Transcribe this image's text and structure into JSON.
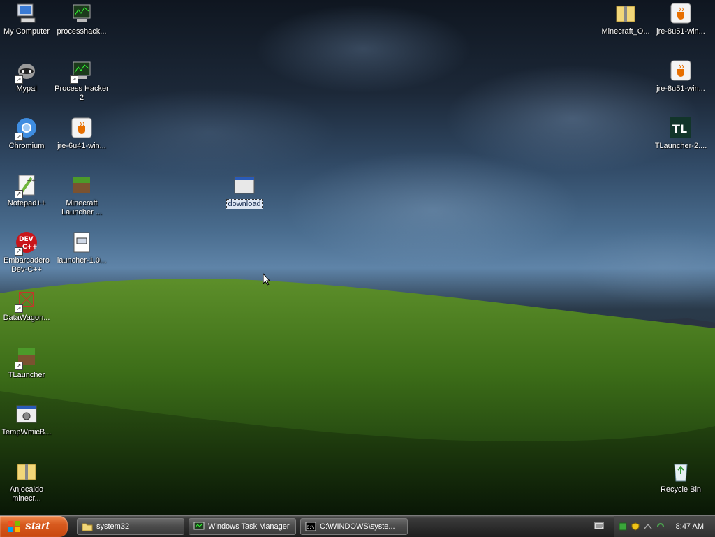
{
  "desktop": {
    "icons_left_col1": [
      {
        "label": "My Computer",
        "icon": "my-computer-icon"
      },
      {
        "label": "Mypal",
        "icon": "mypal-icon"
      },
      {
        "label": "Chromium",
        "icon": "chromium-icon"
      },
      {
        "label": "Notepad++",
        "icon": "notepad-plus-plus-icon"
      },
      {
        "label": "Embarcadero Dev-C++",
        "icon": "devcpp-icon"
      },
      {
        "label": "DataWagon...",
        "icon": "datawagon-icon"
      },
      {
        "label": "TLauncher",
        "icon": "tlauncher-grass-icon"
      },
      {
        "label": "TempWmicB...",
        "icon": "batch-file-icon"
      },
      {
        "label": "Anjocaido minecr...",
        "icon": "zip-folder-icon"
      }
    ],
    "icons_left_col2": [
      {
        "label": "processhack...",
        "icon": "process-hacker-icon"
      },
      {
        "label": "Process Hacker 2",
        "icon": "process-hacker-icon"
      },
      {
        "label": "jre-6u41-win...",
        "icon": "java-installer-icon"
      },
      {
        "label": "Minecraft Launcher ...",
        "icon": "minecraft-grass-icon"
      },
      {
        "label": "launcher-1.0...",
        "icon": "document-icon"
      }
    ],
    "icons_right": [
      {
        "label": "Minecraft_O...",
        "icon": "zip-folder-icon"
      },
      {
        "label": "jre-8u51-win...",
        "icon": "java-installer-icon"
      },
      {
        "label": "jre-8u51-win...",
        "icon": "java-installer-icon"
      },
      {
        "label": "TLauncher-2....",
        "icon": "tlauncher-tl-icon"
      },
      {
        "label": "Recycle Bin",
        "icon": "recycle-bin-icon"
      }
    ],
    "selected_icon": {
      "label": "download",
      "icon": "window-app-icon"
    },
    "tl_text": "TL",
    "dev_text": "DEV",
    "dev_text2": "C++"
  },
  "taskbar": {
    "start_label": "start",
    "tasks": [
      {
        "label": "system32",
        "icon": "folder-icon"
      },
      {
        "label": "Windows Task Manager",
        "icon": "task-manager-icon"
      },
      {
        "label": "C:\\WINDOWS\\syste...",
        "icon": "cmd-icon"
      }
    ],
    "cmd_icon_text": "C:\\",
    "clock": "8:47 AM"
  },
  "colors": {
    "start": "#d75a1e",
    "grass": "#3f7a1a",
    "sky": "#4a6d8f"
  }
}
